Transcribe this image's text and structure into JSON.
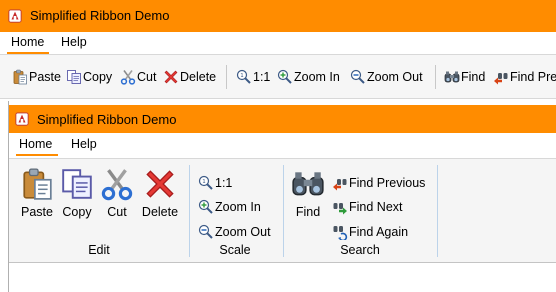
{
  "window": {
    "title": "Simplified Ribbon Demo"
  },
  "menu": {
    "home": "Home",
    "help": "Help"
  },
  "qat": {
    "paste": "Paste",
    "copy": "Copy",
    "cut": "Cut",
    "delete": "Delete",
    "zoom_1_1": "1:1",
    "zoom_in": "Zoom In",
    "zoom_out": "Zoom Out",
    "find": "Find",
    "find_previous": "Find Pre"
  },
  "inner_window": {
    "title": "Simplified Ribbon Demo"
  },
  "inner_menu": {
    "home": "Home",
    "help": "Help"
  },
  "ribbon": {
    "edit": {
      "label": "Edit",
      "paste": "Paste",
      "copy": "Copy",
      "cut": "Cut",
      "delete": "Delete"
    },
    "scale": {
      "label": "Scale",
      "zoom_1_1": "1:1",
      "zoom_in": "Zoom In",
      "zoom_out": "Zoom Out"
    },
    "search": {
      "label": "Search",
      "find": "Find",
      "find_previous": "Find Previous",
      "find_next": "Find Next",
      "find_again": "Find Again"
    }
  },
  "colors": {
    "accent": "#ff8c00",
    "ribbon_bg": "#f5f5f5",
    "separator": "#bcd3ea"
  },
  "icons": [
    "app-icon",
    "paste-icon",
    "copy-icon",
    "cut-icon",
    "delete-icon",
    "zoom-1-1-icon",
    "zoom-in-icon",
    "zoom-out-icon",
    "binoculars-icon",
    "find-previous-icon",
    "find-next-icon",
    "find-again-icon"
  ]
}
